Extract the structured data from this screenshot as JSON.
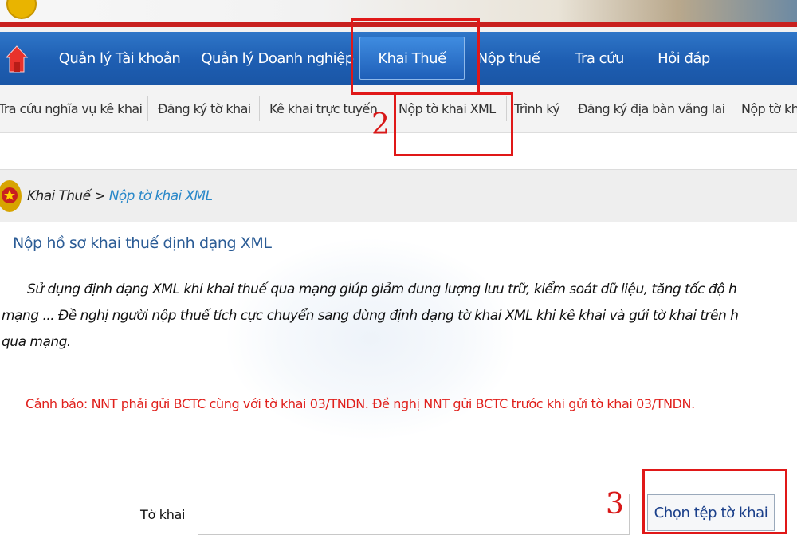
{
  "nav": {
    "items": [
      {
        "label": "Quản lý Tài khoản"
      },
      {
        "label": "Quản lý Doanh nghiệp"
      },
      {
        "label": "Khai Thuế"
      },
      {
        "label": "Nộp thuế"
      },
      {
        "label": "Tra cứu"
      },
      {
        "label": "Hỏi đáp"
      }
    ]
  },
  "subnav": {
    "items": [
      {
        "label": "Tra cứu nghĩa vụ kê khai"
      },
      {
        "label": "Đăng ký tờ khai"
      },
      {
        "label": "Kê khai trực tuyến"
      },
      {
        "label": "Nộp tờ khai XML"
      },
      {
        "label": "Trình ký"
      },
      {
        "label": "Đăng ký địa bàn vãng lai"
      },
      {
        "label": "Nộp tờ kh"
      }
    ]
  },
  "breadcrumb": {
    "root": "Khai Thuế",
    "separator": " > ",
    "current": "Nộp tờ khai XML"
  },
  "page": {
    "title": "Nộp hồ sơ khai thuế định dạng XML",
    "description_lines": [
      "Sử dụng định dạng XML khi khai thuế qua mạng giúp giảm dung lượng lưu trữ, kiểm soát dữ liệu, tăng tốc độ h",
      "mạng ... Đề nghị người nộp thuế tích cực chuyển sang dùng định dạng tờ khai XML khi kê khai và gửi tờ khai trên h",
      "qua mạng."
    ],
    "warning": "Cảnh báo: NNT phải gửi BCTC cùng với tờ khai 03/TNDN. Đề nghị NNT gửi BCTC trước khi gửi tờ khai 03/TNDN."
  },
  "form": {
    "field_label": "Tờ khai",
    "field_value": "",
    "choose_button": "Chọn tệp tờ khai"
  },
  "annotations": {
    "step2": "2",
    "step3": "3",
    "color": "#e01818"
  },
  "colors": {
    "nav_bg": "#1e5eb2",
    "banner_red": "#c8201f",
    "breadcrumb_link": "#2a88c9",
    "title": "#2a5b95",
    "warning": "#e0201c"
  }
}
